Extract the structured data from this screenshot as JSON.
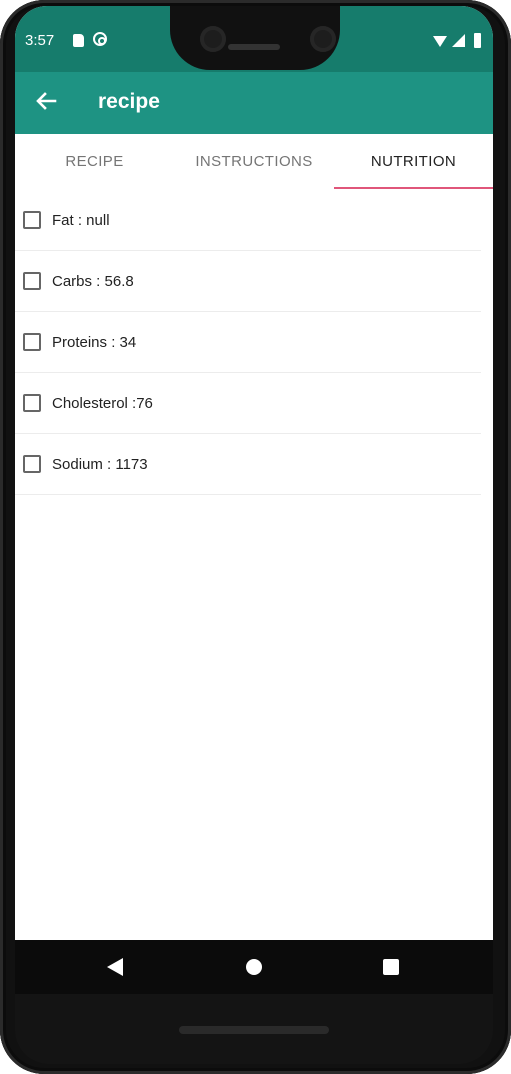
{
  "status_bar": {
    "time": "3:57",
    "icons": [
      "sd-card-icon",
      "sync-icon",
      "wifi-icon",
      "cell-signal-icon",
      "battery-icon"
    ]
  },
  "app_bar": {
    "title": "recipe",
    "back_icon": "arrow-left-icon"
  },
  "tabs": [
    {
      "label": "RECIPE",
      "active": false
    },
    {
      "label": "INSTRUCTIONS",
      "active": false
    },
    {
      "label": "NUTRITION",
      "active": true
    }
  ],
  "nutrition_items": [
    {
      "label": "Fat : null",
      "checked": false
    },
    {
      "label": "Carbs : 56.8",
      "checked": false
    },
    {
      "label": "Proteins : 34",
      "checked": false
    },
    {
      "label": "Cholesterol :76",
      "checked": false
    },
    {
      "label": "Sodium : 1173",
      "checked": false
    }
  ],
  "nav_bar": {
    "icons": [
      "nav-back-icon",
      "nav-home-icon",
      "nav-recents-icon"
    ]
  },
  "colors": {
    "status_bar": "#167c6c",
    "app_bar": "#1e9383",
    "tab_indicator": "#e0567a"
  }
}
